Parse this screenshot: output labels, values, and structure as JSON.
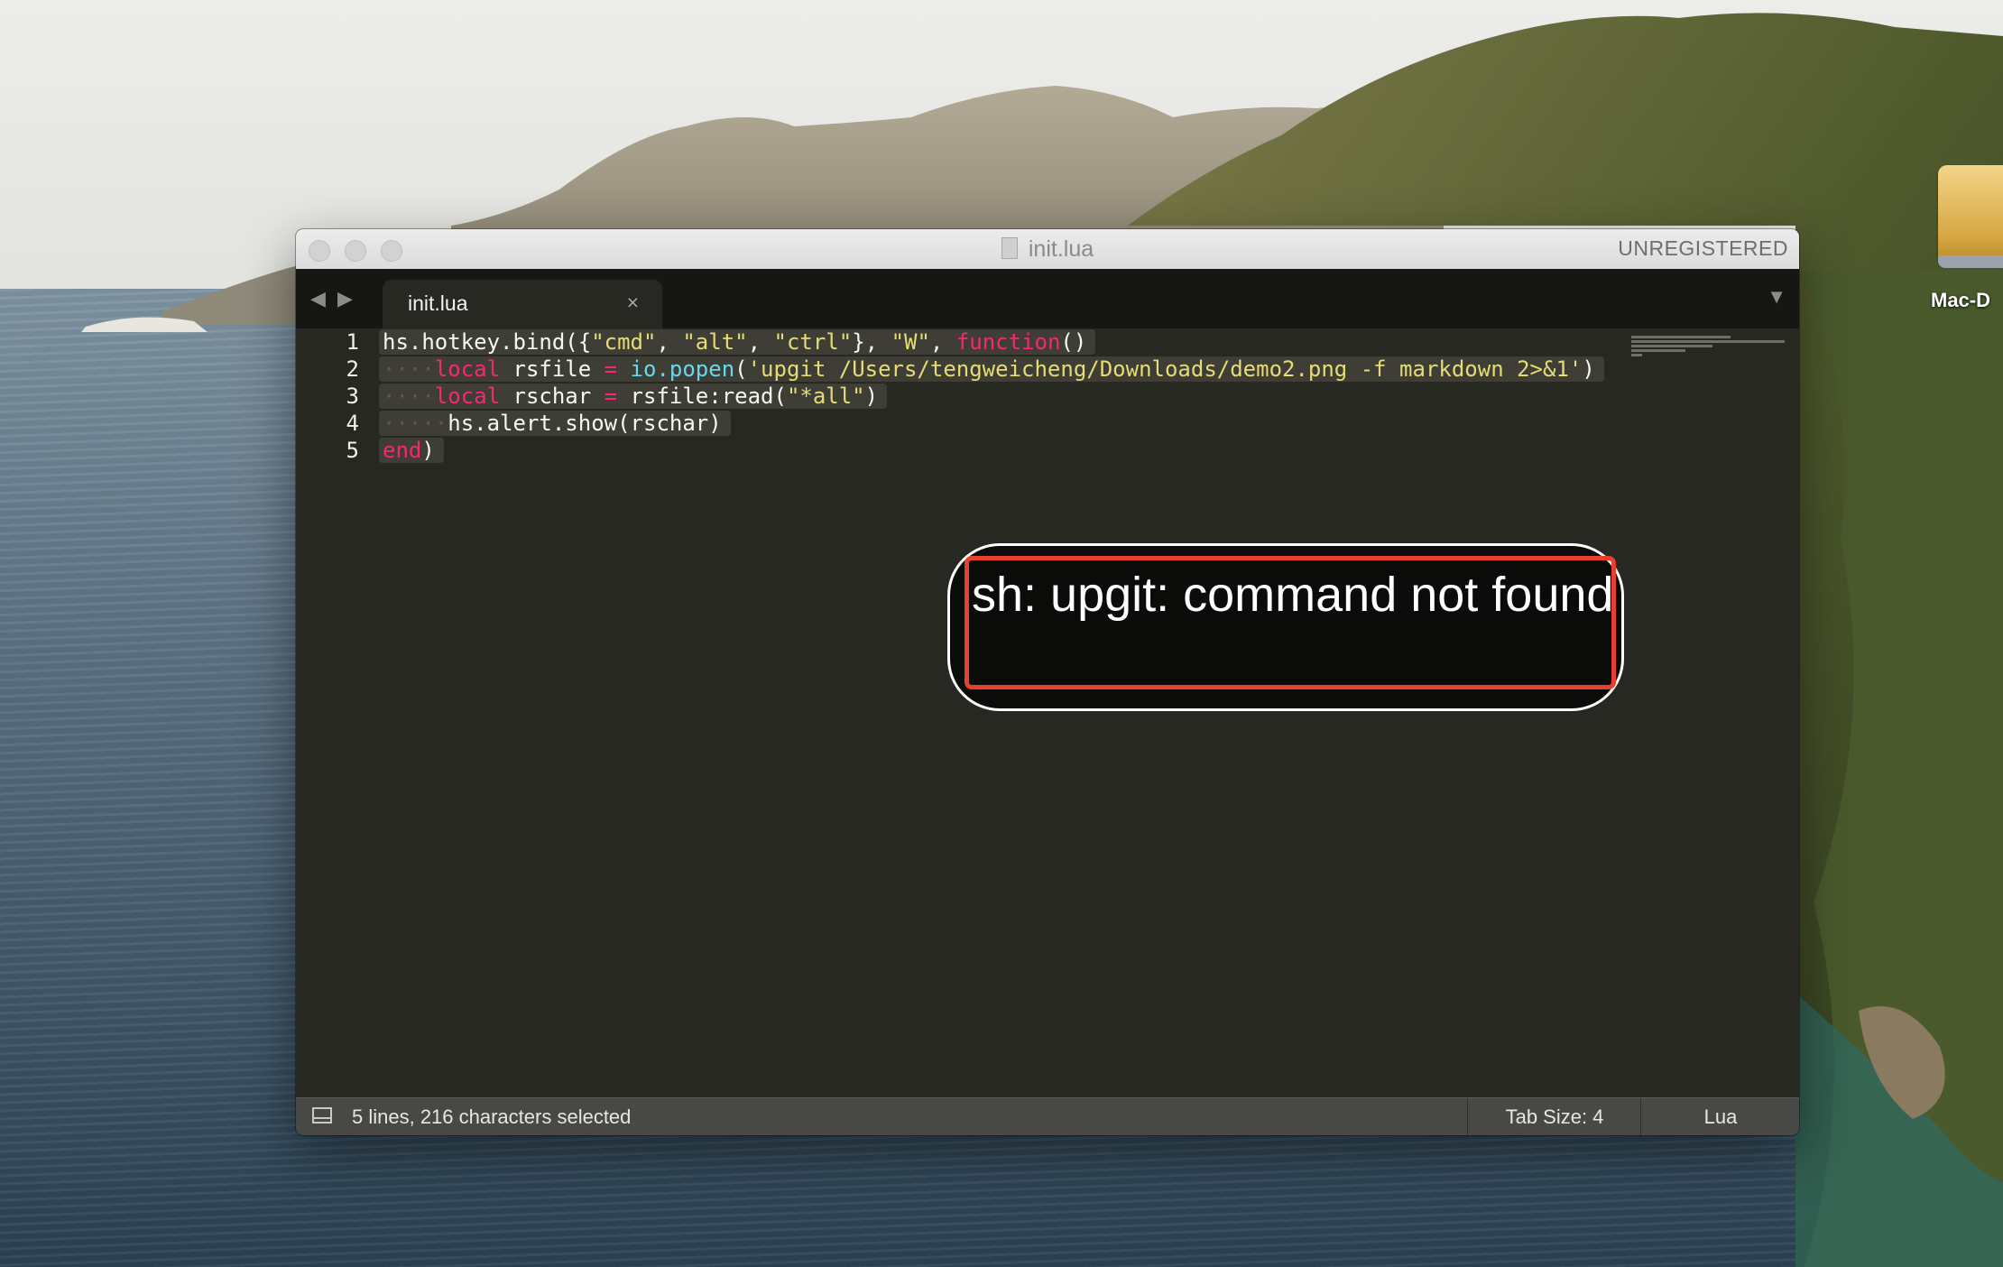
{
  "desktop": {
    "icon_label": "Mac-D"
  },
  "window": {
    "title": "init.lua",
    "license_status": "UNREGISTERED",
    "tab": {
      "label": "init.lua",
      "close_glyph": "×"
    },
    "nav": {
      "back_glyph": "◀",
      "forward_glyph": "▶",
      "tab_menu_glyph": "▼"
    },
    "code": {
      "line_numbers": [
        "1",
        "2",
        "3",
        "4",
        "5"
      ],
      "lines": [
        "hs.hotkey.bind({\"cmd\", \"alt\", \"ctrl\"}, \"W\", function()",
        "    local rsfile = io.popen('upgit /Users/tengweicheng/Downloads/demo2.png -f markdown 2>&1')",
        "    local rschar = rsfile:read(\"*all\")",
        "     hs.alert.show(rschar)",
        "end)"
      ],
      "language": "Lua"
    },
    "status": {
      "selection_info": "5 lines, 216 characters selected",
      "tab_size": "Tab Size: 4",
      "syntax": "Lua"
    }
  },
  "alert": {
    "message": "sh: upgit: command not found"
  },
  "colors": {
    "editor_bg": "#272822",
    "keyword": "#f92672",
    "string": "#e6db74",
    "function": "#66d9ef",
    "highlight_border": "#e8402c"
  }
}
